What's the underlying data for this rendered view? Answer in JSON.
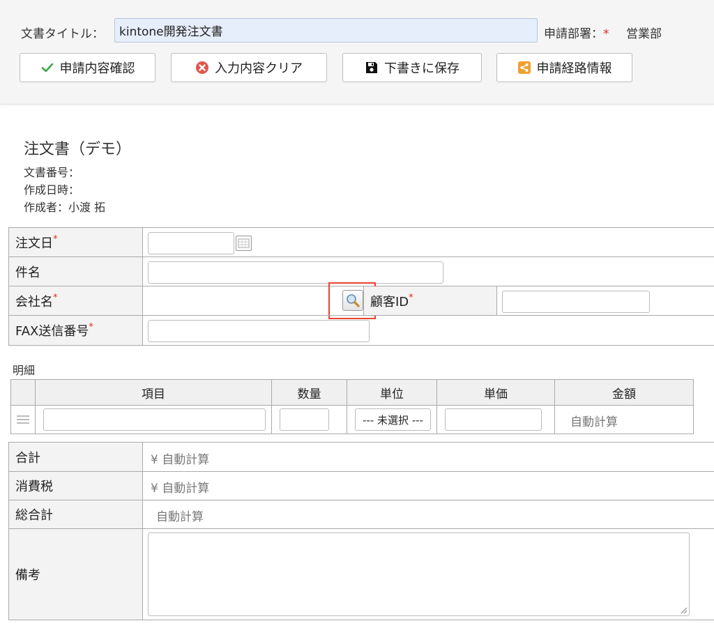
{
  "header": {
    "title_label": "文書タイトル：",
    "title_value": "kintone開発注文書",
    "dept_label": "申請部署：",
    "dept_required": "*",
    "dept_value": "営業部"
  },
  "buttons": {
    "confirm": "申請内容確認",
    "clear": "入力内容クリア",
    "save": "下書きに保存",
    "route": "申請経路情報"
  },
  "document": {
    "title": "注文書（デモ）",
    "number_label": "文書番号：",
    "created_label": "作成日時：",
    "author_label": "作成者：小渡 拓"
  },
  "form": {
    "order_date": "注文日",
    "subject": "件名",
    "company": "会社名",
    "customer_id": "顧客ID",
    "fax": "FAX送信番号",
    "required_mark": "*"
  },
  "details": {
    "section_label": "明細",
    "columns": [
      "項目",
      "数量",
      "単位",
      "単価",
      "金額"
    ],
    "unit_select": "--- 未選択 ---",
    "amount_auto": "自動計算"
  },
  "totals": {
    "subtotal_label": "合計",
    "subtotal_value": "¥ 自動計算",
    "tax_label": "消費税",
    "tax_value": "¥ 自動計算",
    "grand_label": "総合計",
    "grand_value": "自動計算",
    "remarks_label": "備考"
  },
  "colors": {
    "required": "#e0291e",
    "highlight": "#e8432e",
    "check": "#3aa84a",
    "clear": "#e2574c",
    "route": "#f0a030"
  }
}
